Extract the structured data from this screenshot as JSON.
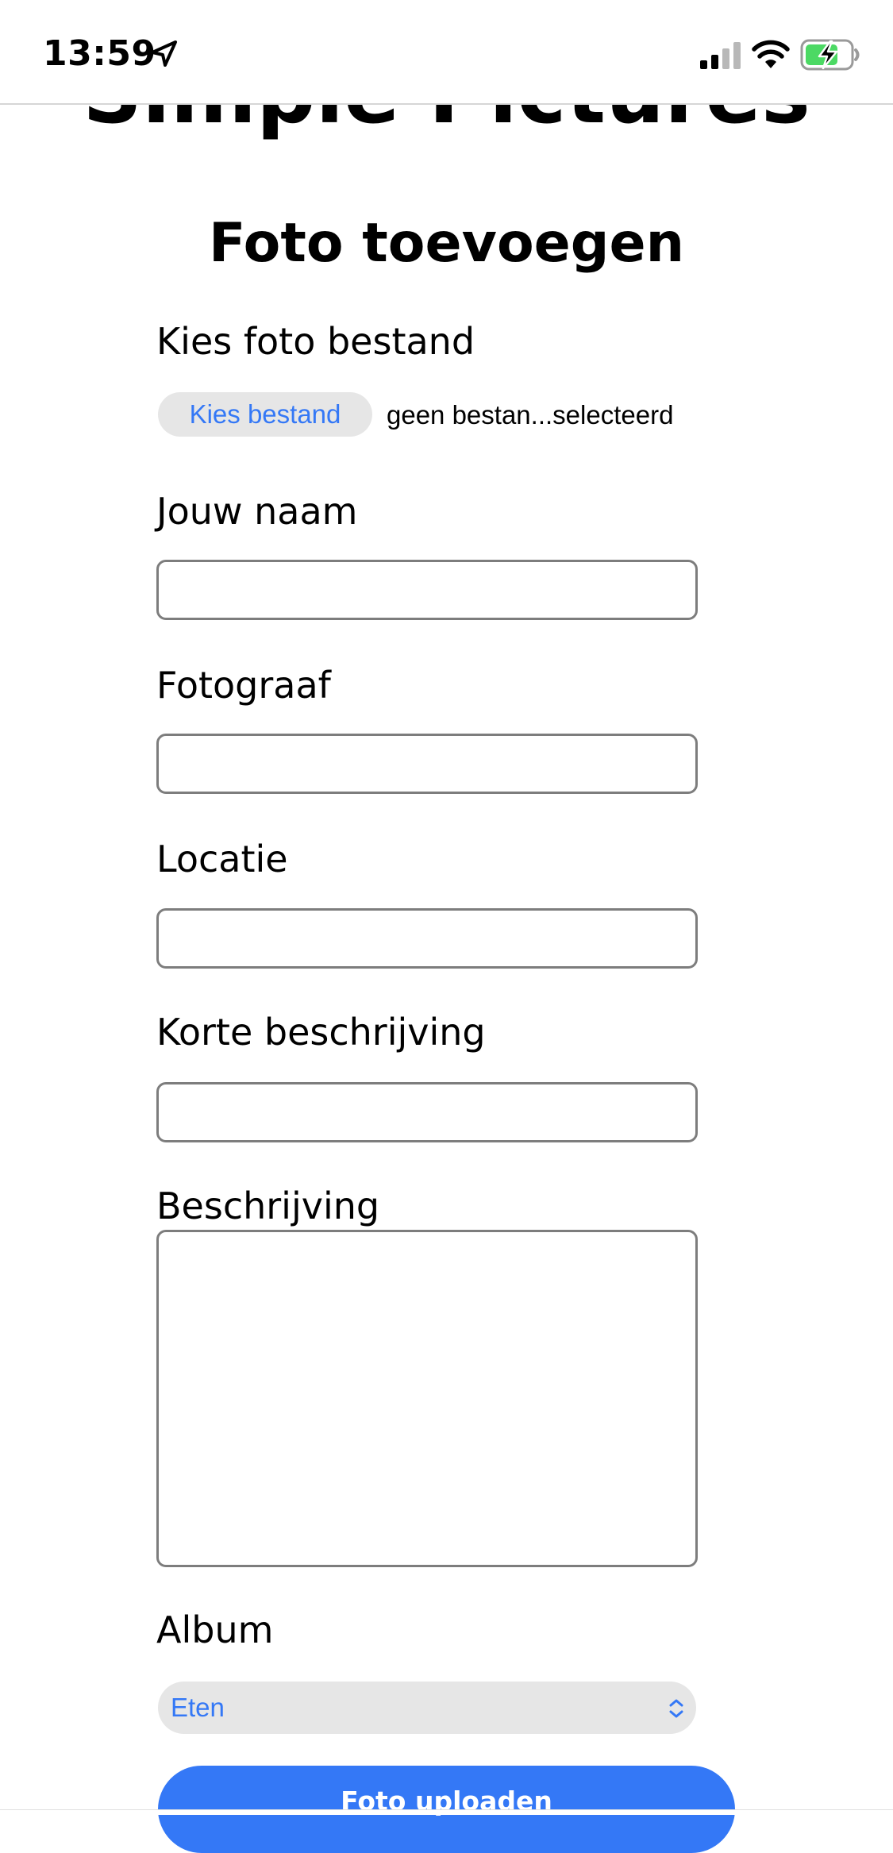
{
  "status_bar": {
    "time": "13:59",
    "icons": [
      "location-arrow-icon",
      "cellular-signal-icon",
      "wifi-icon",
      "battery-charging-icon"
    ],
    "battery_color": "#4cd964"
  },
  "page": {
    "site_title": "Simple Pictures",
    "form_heading": "Foto toevoegen"
  },
  "form": {
    "file_label": "Kies foto bestand",
    "file_button_label": "Kies bestand",
    "file_status": "geen bestan...selecteerd",
    "name_label": "Jouw naam",
    "name_value": "",
    "photographer_label": "Fotograaf",
    "photographer_value": "",
    "location_label": "Locatie",
    "location_value": "",
    "short_description_label": "Korte beschrijving",
    "short_description_value": "",
    "description_label": "Beschrijving",
    "description_value": "",
    "album_label": "Album",
    "album_selected": "Eten",
    "submit_label": "Foto uploaden"
  },
  "colors": {
    "accent": "#3478f6",
    "control_background": "#e6e6e6",
    "input_border": "#7d7d7d"
  }
}
